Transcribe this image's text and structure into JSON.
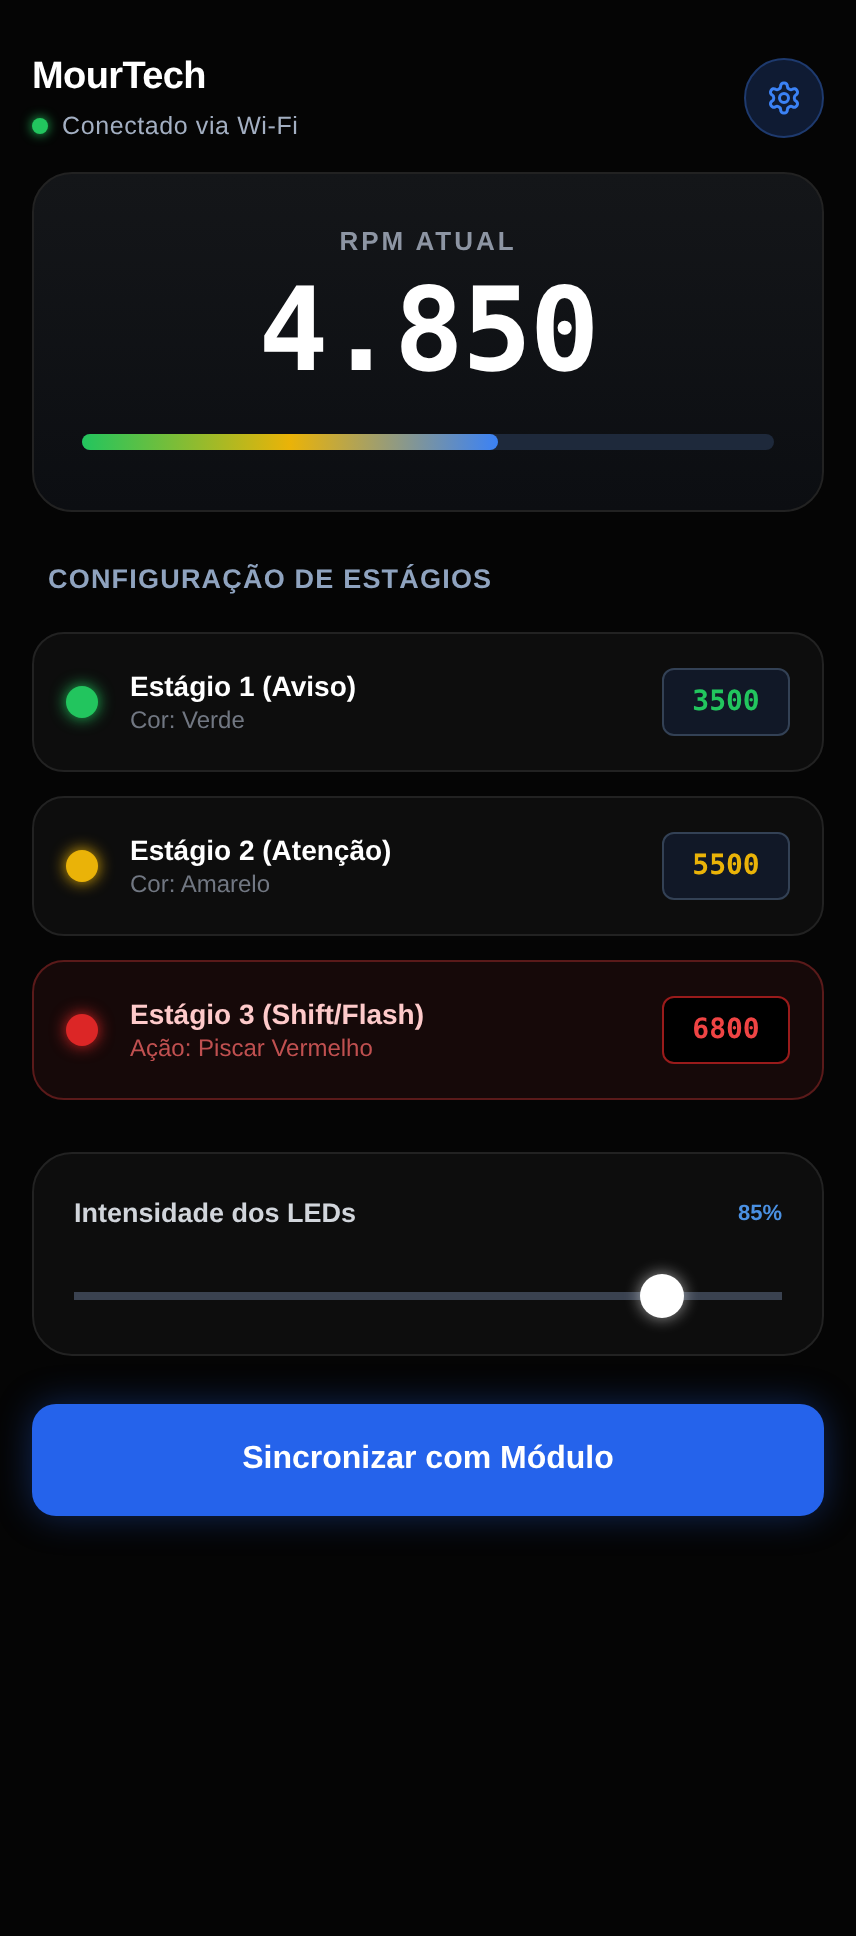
{
  "header": {
    "title": "MourTech",
    "status": "Conectado via Wi-Fi",
    "connected": true
  },
  "rpm": {
    "label": "RPM ATUAL",
    "value": "4.850",
    "level": 0.6
  },
  "section_title": "CONFIGURAÇÃO DE ESTÁGIOS",
  "stages": [
    {
      "kind": "stage",
      "title": "Estágio 1 (Aviso)",
      "subtitle": "Cor: Verde",
      "value": "3500",
      "color": "#22c55e"
    },
    {
      "kind": "stage",
      "title": "Estágio 2 (Atenção)",
      "subtitle": "Cor: Amarelo",
      "value": "5500",
      "color": "#eab308"
    },
    {
      "kind": "shift",
      "title": "Estágio 3 (Shift/Flash)",
      "subtitle": "Ação: Piscar Vermelho",
      "value": "6800",
      "color": "#dc2626"
    }
  ],
  "brightness": {
    "label": "Intensidade dos LEDs",
    "reading": "85%",
    "level": 0.83
  },
  "sync_button": "Sincronizar com Módulo"
}
